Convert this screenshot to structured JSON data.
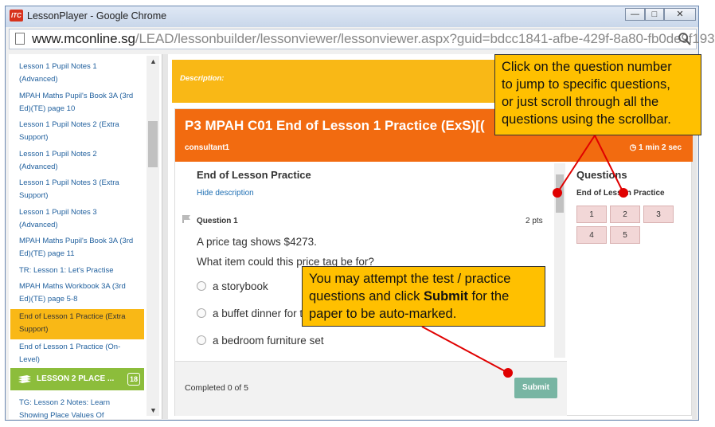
{
  "window": {
    "title": "LessonPlayer - Google Chrome",
    "app_icon_text": "ITC"
  },
  "address": {
    "host": "www.mconline.sg",
    "path": "/LEAD/lessonbuilder/lessonviewer/lessonviewer.aspx?guid=bdcc1841-afbe-429f-8a80-fb0de9f193"
  },
  "sidebar": {
    "items": [
      {
        "label": "Lesson 1 Pupil Notes 1",
        "label2": "(Advanced)"
      },
      {
        "label": "MPAH Maths Pupil's Book 3A (3rd",
        "label2": "Ed)(TE) page 10"
      },
      {
        "label": "Lesson 1 Pupil Notes 2 (Extra",
        "label2": "Support)"
      },
      {
        "label": "Lesson 1 Pupil Notes 2",
        "label2": "(Advanced)"
      },
      {
        "label": "Lesson 1 Pupil Notes 3 (Extra",
        "label2": "Support)"
      },
      {
        "label": "Lesson 1 Pupil Notes 3",
        "label2": "(Advanced)"
      },
      {
        "label": "MPAH Maths Pupil's Book 3A (3rd",
        "label2": "Ed)(TE) page 11"
      },
      {
        "label": "TR: Lesson 1: Let's Practise",
        "label2": ""
      },
      {
        "label": "MPAH Maths Workbook 3A (3rd",
        "label2": "Ed)(TE) page 5-8"
      },
      {
        "label": "End of Lesson 1 Practice (Extra",
        "label2": "Support)"
      },
      {
        "label": "End of Lesson 1 Practice (On-",
        "label2": "Level)"
      }
    ],
    "lesson2": {
      "label": "LESSON 2 PLACE ...",
      "count": "18"
    },
    "bottom_item": {
      "label": "TG: Lesson 2 Notes: Learn",
      "label2": "Showing Place Values Of"
    }
  },
  "description": {
    "label": "Description:"
  },
  "practice": {
    "title": "P3 MPAH C01 End of Lesson 1 Practice (ExS)[(",
    "user": "consultant1",
    "timer": "1 min 2 sec",
    "section_title": "End of Lesson Practice",
    "hide_link": "Hide description",
    "question_label": "Question 1",
    "points": "2 pts",
    "q_line1": "A price tag shows $4273.",
    "q_line2": "What item could this price tag be for?",
    "options": [
      "a storybook",
      "a buffet dinner for two",
      "a bedroom furniture set"
    ],
    "completed": "Completed 0 of 5",
    "submit": "Submit"
  },
  "questions_panel": {
    "heading": "Questions",
    "subheading": "End of Lesson Practice",
    "numbers": [
      "1",
      "2",
      "3",
      "4",
      "5"
    ]
  },
  "callouts": {
    "top": [
      "Click on the question number",
      "to jump to specific questions,",
      "or just scroll through all the",
      "questions using the scrollbar."
    ],
    "bottom": {
      "line1": "You may attempt the test / practice",
      "line2_pre": "questions and click ",
      "line2_bold": "Submit",
      "line2_post": " for the",
      "line3": "paper to be auto-marked."
    }
  }
}
